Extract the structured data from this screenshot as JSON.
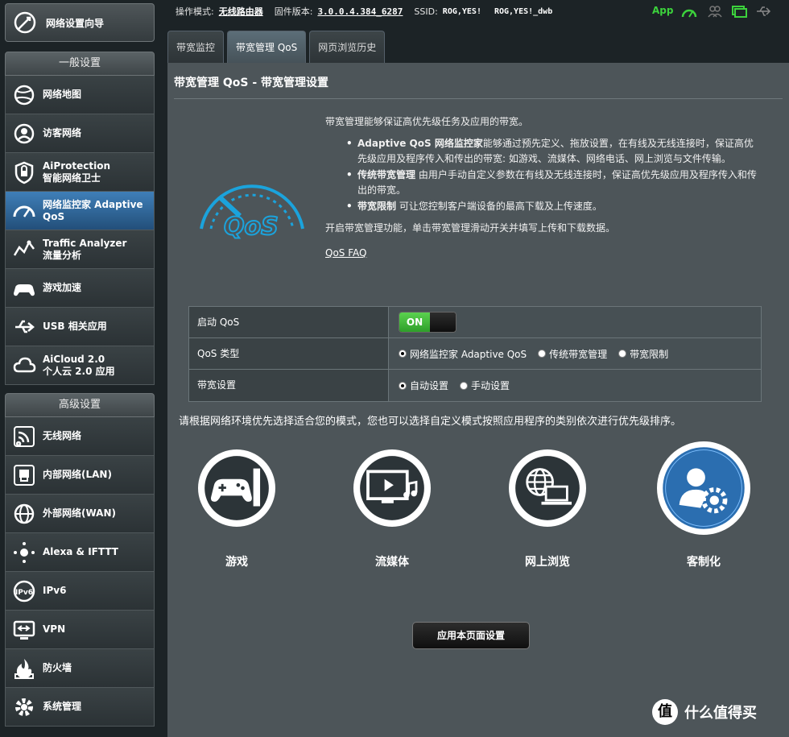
{
  "status_bar": {
    "mode_label": "操作模式:",
    "mode_value": "无线路由器",
    "firmware_label": "固件版本:",
    "firmware_value": "3.0.0.4.384_6287",
    "ssid_label": "SSID:",
    "ssid_1": "ROG,YES!",
    "ssid_2": "ROG,YES!_dwb",
    "app_label": "App",
    "icons": [
      "connection-status-icon",
      "users-icon",
      "network-icon",
      "usb-icon"
    ]
  },
  "sidebar": {
    "wizard": "网络设置向导",
    "general_title": "一般设置",
    "general_items": [
      {
        "label": "网络地图",
        "icon": "map-icon"
      },
      {
        "label": "访客网络",
        "icon": "guest-network-icon"
      },
      {
        "label": "AiProtection\n智能网络卫士",
        "icon": "shield-icon"
      },
      {
        "label": "网络监控家 Adaptive\nQoS",
        "icon": "qos-gauge-icon",
        "active": true
      },
      {
        "label": "Traffic Analyzer\n流量分析",
        "icon": "traffic-icon"
      },
      {
        "label": "游戏加速",
        "icon": "gamepad-icon"
      },
      {
        "label": "USB 相关应用",
        "icon": "usb-app-icon"
      },
      {
        "label": "AiCloud 2.0\n个人云 2.0 应用",
        "icon": "cloud-icon"
      }
    ],
    "advanced_title": "高级设置",
    "advanced_items": [
      {
        "label": "无线网络",
        "icon": "wireless-icon"
      },
      {
        "label": "内部网络(LAN)",
        "icon": "lan-icon"
      },
      {
        "label": "外部网络(WAN)",
        "icon": "wan-globe-icon"
      },
      {
        "label": "Alexa & IFTTT",
        "icon": "alexa-icon"
      },
      {
        "label": "IPv6",
        "icon": "ipv6-icon"
      },
      {
        "label": "VPN",
        "icon": "vpn-icon"
      },
      {
        "label": "防火墙",
        "icon": "firewall-icon"
      },
      {
        "label": "系统管理",
        "icon": "system-gear-icon"
      }
    ]
  },
  "tabs": [
    {
      "label": "带宽监控",
      "active": false
    },
    {
      "label": "带宽管理 QoS",
      "active": true
    },
    {
      "label": "网页浏览历史",
      "active": false
    }
  ],
  "main": {
    "title": "带宽管理 QoS - 带宽管理设置",
    "intro": "带宽管理能够保证高优先级任务及应用的带宽。",
    "bullets": [
      {
        "bold": "Adaptive QoS 网络监控家",
        "text": "能够通过预先定义、拖放设置，在有线及无线连接时，保证高优先级应用及程序传入和传出的带宽: 如游戏、流媒体、网络电话、网上浏览与文件传输。"
      },
      {
        "bold": "传统带宽管理",
        "text": " 由用户手动自定义参数在有线及无线连接时，保证高优先级应用及程序传入和传出的带宽。"
      },
      {
        "bold": "带宽限制",
        "text": " 可让您控制客户端设备的最高下载及上传速度。"
      }
    ],
    "hint": "开启带宽管理功能，单击带宽管理滑动开关并填写上传和下载数据。",
    "faq": "QoS FAQ",
    "logo_text": "QoS"
  },
  "settings": {
    "enable_label": "启动 QoS",
    "enable_value": "ON",
    "type_label": "QoS 类型",
    "type_options": [
      {
        "label": "网络监控家 Adaptive QoS",
        "selected": true
      },
      {
        "label": "传统带宽管理",
        "selected": false
      },
      {
        "label": "带宽限制",
        "selected": false
      }
    ],
    "bandwidth_label": "带宽设置",
    "bandwidth_options": [
      {
        "label": "自动设置",
        "selected": true
      },
      {
        "label": "手动设置",
        "selected": false
      }
    ]
  },
  "prompt": "请根据网络环境优先选择适合您的模式，您也可以选择自定义模式按照应用程序的类别依次进行优先级排序。",
  "modes": [
    {
      "label": "游戏",
      "icon": "gamepad-icon",
      "selected": false
    },
    {
      "label": "流媒体",
      "icon": "media-icon",
      "selected": false
    },
    {
      "label": "网上浏览",
      "icon": "web-browse-icon",
      "selected": false
    },
    {
      "label": "客制化",
      "icon": "customize-icon",
      "selected": true
    }
  ],
  "apply_label": "应用本页面设置",
  "watermark": {
    "badge": "值",
    "text": "什么值得买"
  },
  "colors": {
    "accent_blue": "#2b6eb0",
    "toggle_green": "#3fbf37",
    "panel_bg": "#4d5559"
  }
}
